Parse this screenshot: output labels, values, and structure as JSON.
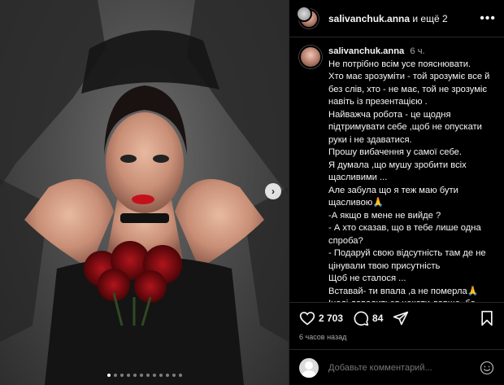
{
  "header": {
    "username": "salivanchuk.anna",
    "others": "и ещё 2",
    "more_icon": "more-horizontal-icon"
  },
  "caption": {
    "username": "salivanchuk.anna",
    "time": "6 ч.",
    "lines": [
      "Не потрібно всім усе пояснювати.",
      "Хто має зрозуміти - той зрозуміє все й без слів, хто - не має, той не зрозуміє навіть із презентацією .",
      "Найважча робота - це щодня підтримувати себе ,щоб не опускати руки і не здаватися.",
      "Прошу вибачення у самої себе.",
      "Я думала ,що мушу зробити всіх щасливими ...",
      "Але забула що я теж маю бути щасливою🙏",
      "-А якщо в мене не вийде ?",
      "- А хто сказав, що в тебе лише одна спроба?",
      "- Подаруй свою відсутність там де не цінували твою присутність",
      "Щоб не сталося ...",
      "Вставай- ти впала ,а не померла🙏",
      "Іноді доводиться чекати довше, бо винагорода більша"
    ]
  },
  "actions": {
    "likes": "2 703",
    "comments": "84"
  },
  "timestamp": "6 часов назад",
  "comment_box": {
    "placeholder": "Добавьте комментарий..."
  },
  "carousel": {
    "slide_count": 12,
    "active_index": 0
  }
}
